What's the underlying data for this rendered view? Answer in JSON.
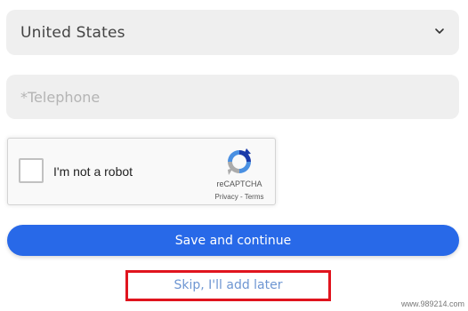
{
  "form": {
    "country": {
      "selected": "United States",
      "icon": "chevron-down-icon"
    },
    "telephone": {
      "placeholder": "*Telephone",
      "value": ""
    },
    "recaptcha": {
      "label": "I'm not a robot",
      "brand": "reCAPTCHA",
      "privacy_link": "Privacy",
      "separator": " - ",
      "terms_link": "Terms",
      "checked": false
    },
    "save_button": "Save and continue",
    "skip_link": "Skip, I'll add later"
  },
  "watermark": "www.989214.com",
  "colors": {
    "primary": "#2869e8",
    "field_bg": "#efefef",
    "skip_link": "#6e96d2",
    "highlight": "#e0141e"
  }
}
